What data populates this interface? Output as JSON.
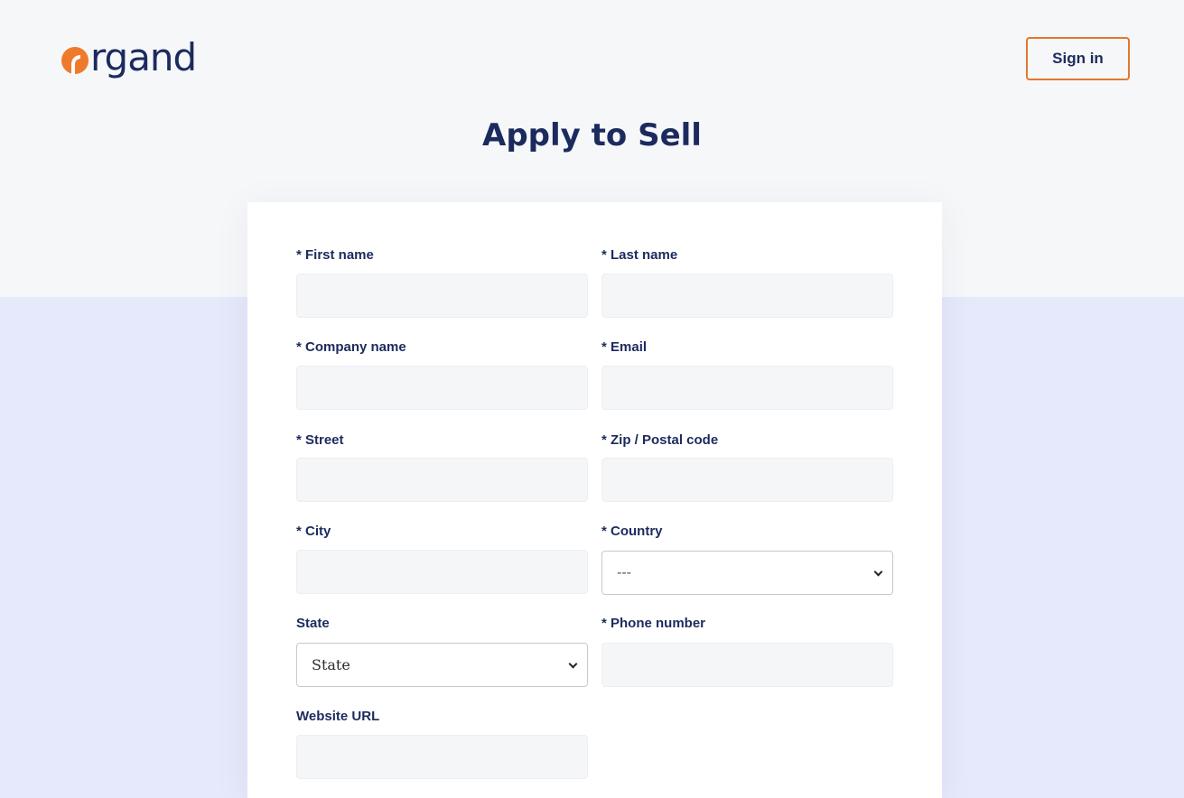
{
  "header": {
    "logo_text": "rgand",
    "signin_label": "Sign in"
  },
  "page": {
    "title": "Apply to Sell"
  },
  "form": {
    "first_name_label": "* First name",
    "last_name_label": "* Last name",
    "company_name_label": "* Company name",
    "email_label": "* Email",
    "street_label": "* Street",
    "zip_label": "* Zip / Postal code",
    "city_label": "* City",
    "country_label": "* Country",
    "country_value": "---",
    "state_label": "State",
    "state_value": "State",
    "phone_label": "* Phone number",
    "website_label": "Website URL"
  },
  "colors": {
    "brand_orange": "#ee7b2c",
    "navy": "#1c2b5e",
    "top_background": "#f6f7f9",
    "bottom_background": "#e6e8fb"
  },
  "icons": {
    "logo": "orange-circle-logo-icon",
    "select": "chevron-down-icon"
  }
}
